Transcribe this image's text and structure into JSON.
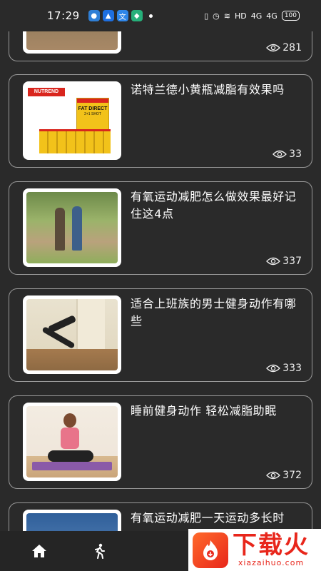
{
  "status_bar": {
    "time": "17:29",
    "right_text": "HD",
    "signal_a": "4G",
    "signal_b": "4G",
    "battery": "100"
  },
  "feed": [
    {
      "title": "",
      "views": "281",
      "thumb": "path-scene"
    },
    {
      "title": "诺特兰德小黄瓶减脂有效果吗",
      "views": "33",
      "thumb": "nutrend-product"
    },
    {
      "title": "有氧运动减肥怎么做效果最好记住这4点",
      "views": "337",
      "thumb": "couple-walking"
    },
    {
      "title": "适合上班族的男士健身动作有哪些",
      "views": "333",
      "thumb": "man-stretching"
    },
    {
      "title": "睡前健身动作 轻松减脂助眠",
      "views": "372",
      "thumb": "woman-yoga"
    },
    {
      "title": "有氧运动减肥一天运动多长时",
      "views": "",
      "thumb": "sky"
    }
  ],
  "nutrend": {
    "brand": "NUTREND",
    "product": "FAT DIRECT",
    "sub": "2+1 SHOT"
  },
  "bottom_nav": [
    {
      "icon": "home-icon"
    },
    {
      "icon": "running-icon"
    }
  ],
  "watermark": {
    "main": "下载火",
    "sub": "xiazaihuo.com"
  },
  "colors": {
    "background": "#2a2a2a",
    "card_border": "#9a9a9a",
    "watermark_red": "#e8261b"
  }
}
